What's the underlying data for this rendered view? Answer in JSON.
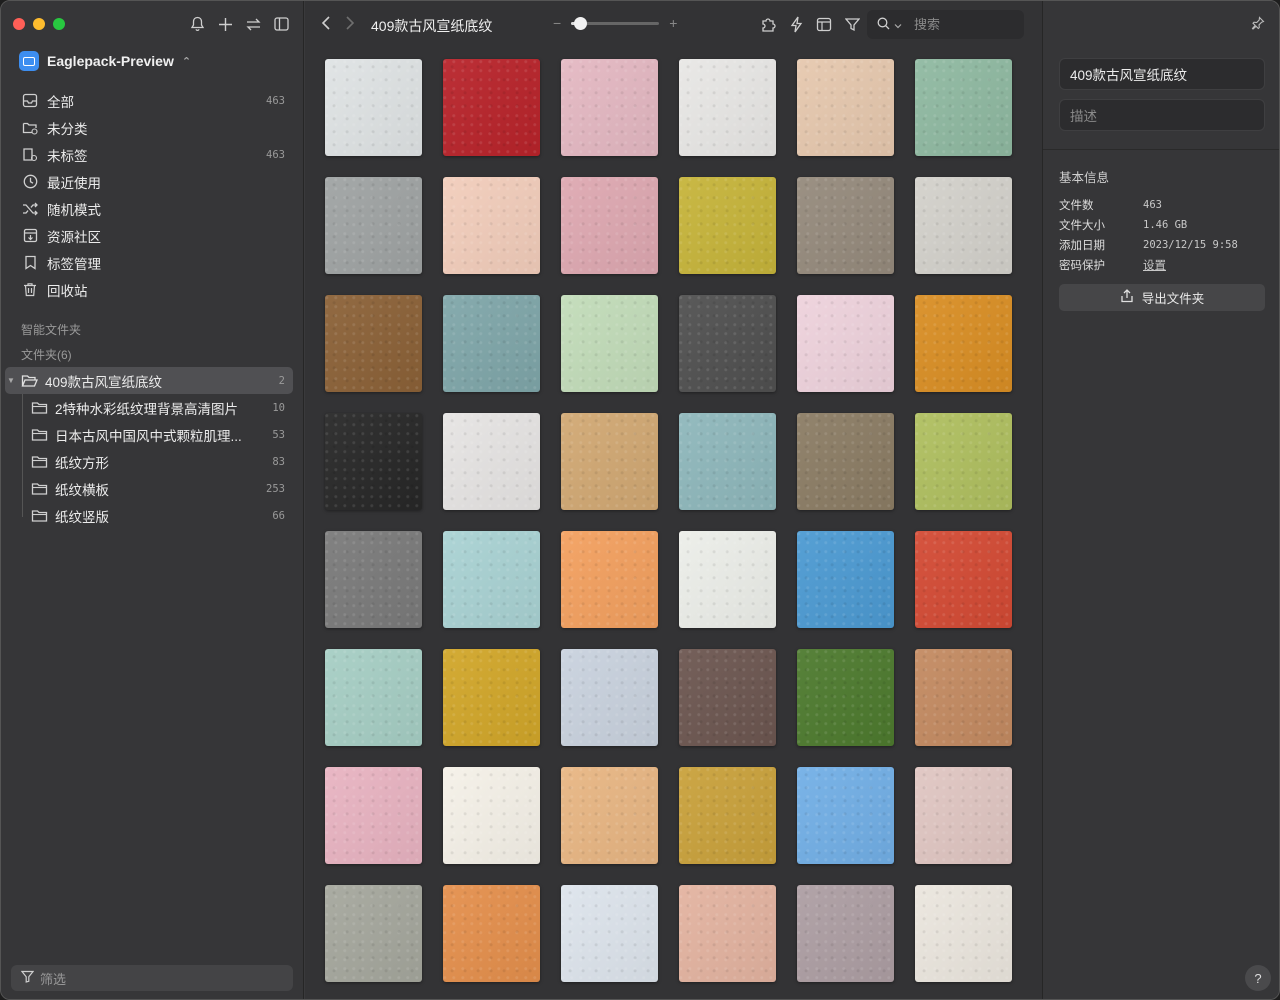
{
  "app": {
    "library_name": "Eaglepack-Preview"
  },
  "sidebar": {
    "nav": [
      {
        "label": "全部",
        "count": "463",
        "icon": "inbox-icon"
      },
      {
        "label": "未分类",
        "count": "",
        "icon": "folder-question-icon"
      },
      {
        "label": "未标签",
        "count": "463",
        "icon": "untagged-icon"
      },
      {
        "label": "最近使用",
        "count": "",
        "icon": "clock-icon"
      },
      {
        "label": "随机模式",
        "count": "",
        "icon": "shuffle-icon"
      },
      {
        "label": "资源社区",
        "count": "",
        "icon": "download-box-icon"
      },
      {
        "label": "标签管理",
        "count": "",
        "icon": "bookmark-icon"
      },
      {
        "label": "回收站",
        "count": "",
        "icon": "trash-icon"
      }
    ],
    "smart_folders_label": "智能文件夹",
    "folders_label": "文件夹(6)",
    "folders": [
      {
        "label": "409款古风宣纸底纹",
        "count": "2",
        "active": true
      },
      {
        "label": "2特种水彩纸纹理背景高清图片",
        "count": "10"
      },
      {
        "label": "日本古风中国风中式颗粒肌理...",
        "count": "53"
      },
      {
        "label": "纸纹方形",
        "count": "83"
      },
      {
        "label": "纸纹横板",
        "count": "253"
      },
      {
        "label": "纸纹竖版",
        "count": "66"
      }
    ],
    "filter_placeholder": "筛选"
  },
  "toolbar": {
    "title": "409款古风宣纸底纹",
    "zoom_minus": "−",
    "zoom_plus": "+",
    "zoom_level": 0.1,
    "search_placeholder": "搜索"
  },
  "grid": {
    "tiles": [
      "#dfe3e4",
      "#b8232a",
      "#e4b8c2",
      "#e8e7e5",
      "#e6c8ae",
      "#8fb9a1",
      "#9fa3a3",
      "#f2cdbb",
      "#dea8b1",
      "#c6b43a",
      "#958a7c",
      "#d3d1cb",
      "#8b6137",
      "#7fa6a9",
      "#c2dcb9",
      "#505050",
      "#eed2dc",
      "#d98e24",
      "#272727",
      "#e6e4e3",
      "#d1a873",
      "#8eb7bb",
      "#8b7c64",
      "#afbf5f",
      "#7a7a7a",
      "#a9d2d3",
      "#f3a05f",
      "#eceee9",
      "#4c9ad2",
      "#d34a34",
      "#a6cec4",
      "#d1a629",
      "#c9d2de",
      "#6c5650",
      "#4d7a2e",
      "#c38a61",
      "#e8b3c1",
      "#f5f1e8",
      "#e8b683",
      "#c9a13b",
      "#72afe6",
      "#e0c6c2",
      "#a5a79d",
      "#e48f4c",
      "#dde4ec",
      "#e3b3a0",
      "#ad9ea3",
      "#ebe6de"
    ]
  },
  "inspector": {
    "name_value": "409款古风宣纸底纹",
    "description_placeholder": "描述",
    "section_title": "基本信息",
    "rows": [
      {
        "key": "文件数",
        "value": "463"
      },
      {
        "key": "文件大小",
        "value": "1.46 GB"
      },
      {
        "key": "添加日期",
        "value": "2023/12/15 9:58"
      },
      {
        "key": "密码保护",
        "value": "设置"
      }
    ],
    "export_label": "导出文件夹",
    "help_label": "?"
  }
}
